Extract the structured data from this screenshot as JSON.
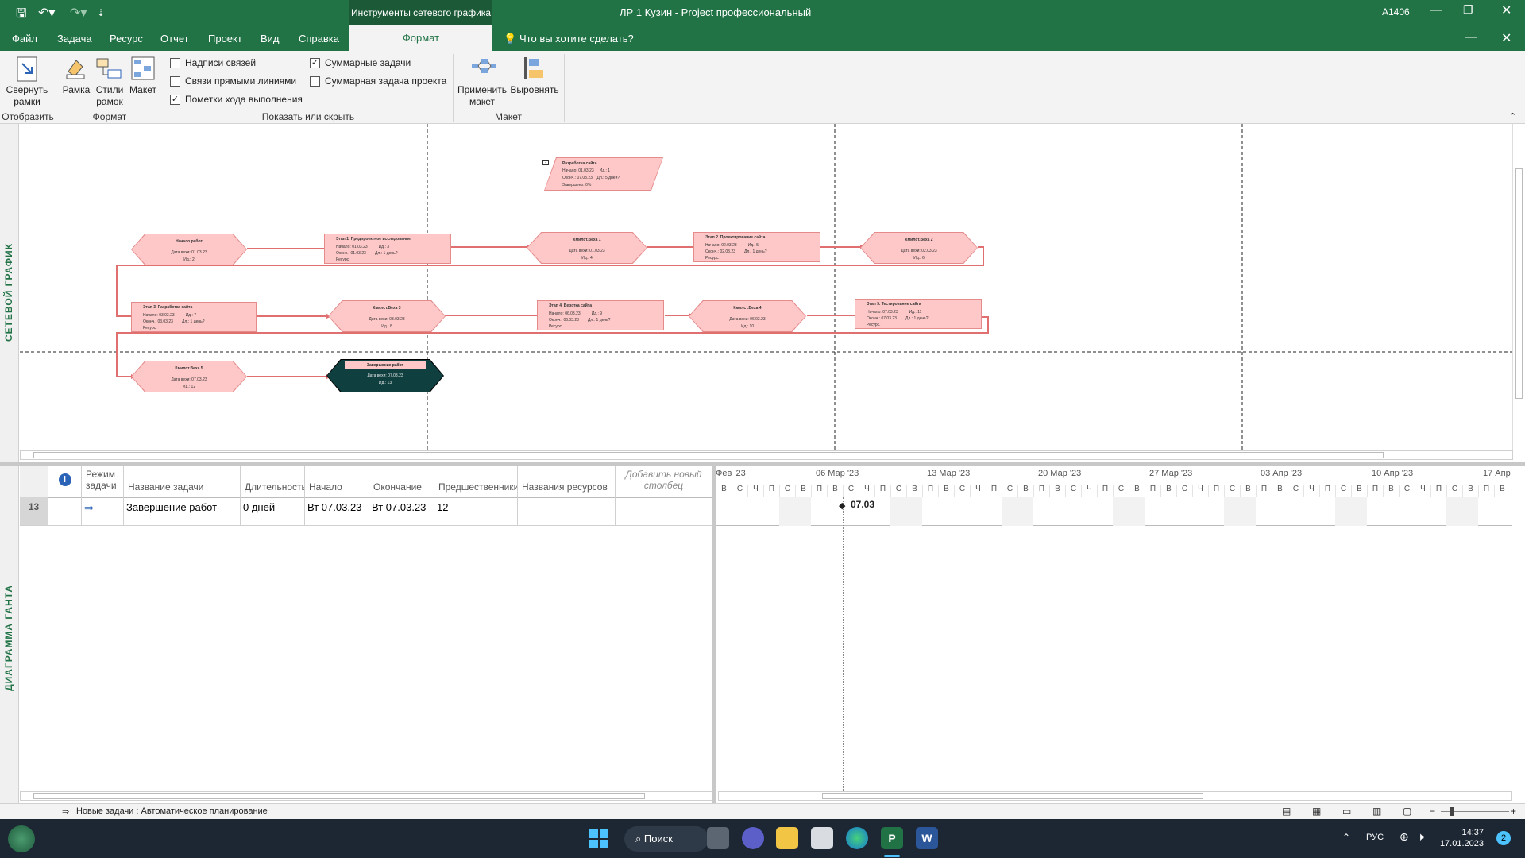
{
  "titlebar": {
    "context_tab": "Инструменты сетевого графика",
    "title": "ЛР 1 Кузин  -  Project профессиональный",
    "user": "А1406"
  },
  "tabs": [
    "Файл",
    "Задача",
    "Ресурс",
    "Отчет",
    "Проект",
    "Вид",
    "Справка",
    "Формат"
  ],
  "search_placeholder": "Что вы хотите сделать?",
  "ribbon": {
    "collapse_label": "Свернуть рамки",
    "box_label": "Рамка",
    "box_styles_label": "Стили рамок",
    "layout_label": "Макет",
    "apply_layout_label": "Применить макет",
    "align_label": "Выровнять",
    "groups": {
      "show": "Отобразить",
      "format": "Формат",
      "show_hide": "Показать или скрыть",
      "layout": "Макет"
    },
    "checkboxes": [
      {
        "label": "Надписи связей",
        "checked": false
      },
      {
        "label": "Связи прямыми линиями",
        "checked": false
      },
      {
        "label": "Пометки хода выполнения",
        "checked": true
      },
      {
        "label": "Суммарные задачи",
        "checked": true
      },
      {
        "label": "Суммарная задача проекта",
        "checked": false
      }
    ]
  },
  "network": {
    "view_label": "СЕТЕВОЙ ГРАФИК",
    "summary": {
      "title": "Разработка сайта",
      "start": "Начало: 01.03.23",
      "id": "Ид.: 1",
      "finish": "Оконч.: 07.03.23",
      "dur": "Дл.: 5 дней?",
      "complete": "Завершено: 0%"
    },
    "nodes": [
      {
        "shape": "hex",
        "title": "Начало работ",
        "date": "Дата вехи: 01.03.23",
        "id": "Ид.: 2"
      },
      {
        "shape": "rect",
        "title": "Этап 1. Предпроектное исследование",
        "start": "Начало: 01.03.23",
        "id": "Ид.: 3",
        "finish": "Оконч.: 01.03.23",
        "dur": "Дл.: 1 день?",
        "res": "Ресурс."
      },
      {
        "shape": "hex",
        "title": "Кмилст.Веха 1",
        "date": "Дата вехи: 01.03.23",
        "id": "Ид.: 4"
      },
      {
        "shape": "rect",
        "title": "Этап 2. Проектирование сайта",
        "start": "Начало: 02.03.23",
        "id": "Ид.: 5",
        "finish": "Оконч.: 02.03.23",
        "dur": "Дл.: 1 день?",
        "res": "Ресурс."
      },
      {
        "shape": "hex",
        "title": "Кмилст.Веха 2",
        "date": "Дата вехи: 02.03.23",
        "id": "Ид.: 6"
      },
      {
        "shape": "rect",
        "title": "Этап 3. Разработка сайта",
        "start": "Начало: 03.03.23",
        "id": "Ид.: 7",
        "finish": "Оконч.: 03.03.23",
        "dur": "Дл.: 1 день?",
        "res": "Ресурс."
      },
      {
        "shape": "hex",
        "title": "Кмилст.Веха 3",
        "date": "Дата вехи: 03.03.23",
        "id": "Ид.: 8"
      },
      {
        "shape": "rect",
        "title": "Этап 4. Верстка сайта",
        "start": "Начало: 06.03.23",
        "id": "Ид.: 9",
        "finish": "Оконч.: 06.03.23",
        "dur": "Дл.: 1 день?",
        "res": "Ресурс."
      },
      {
        "shape": "hex",
        "title": "Кмилст.Веха 4",
        "date": "Дата вехи: 06.03.23",
        "id": "Ид.: 10"
      },
      {
        "shape": "rect",
        "title": "Этап 5. Тестирование сайта",
        "start": "Начало: 07.03.23",
        "id": "Ид.: 11",
        "finish": "Оконч.: 07.03.23",
        "dur": "Дл.: 1 день?",
        "res": "Ресурс."
      },
      {
        "shape": "hex",
        "title": "Кмилст.Веха 5",
        "date": "Дата вехи: 07.03.23",
        "id": "Ид.: 12"
      },
      {
        "shape": "hex-selected",
        "title": "Завершение работ",
        "date": "Дата вехи: 07.03.23",
        "id": "Ид.: 13"
      }
    ]
  },
  "gantt": {
    "view_label": "ДИАГРАММА ГАНТА",
    "columns": [
      "Режим задачи",
      "Название задачи",
      "Длительность",
      "Начало",
      "Окончание",
      "Предшественники",
      "Названия ресурсов",
      "Добавить новый столбец"
    ],
    "row": {
      "num": "13",
      "name": "Завершение работ",
      "duration": "0 дней",
      "start": "Вт 07.03.23",
      "finish": "Вт 07.03.23",
      "pred": "12",
      "res": ""
    },
    "timescale_weeks": [
      "Фев '23",
      "06 Мар '23",
      "13 Мар '23",
      "20 Мар '23",
      "27 Мар '23",
      "03 Апр '23",
      "10 Апр '23",
      "17 Апр"
    ],
    "day_letters": [
      "В",
      "С",
      "Ч",
      "П",
      "С",
      "В",
      "П",
      "В",
      "С",
      "Ч",
      "П",
      "С",
      "В",
      "П",
      "В",
      "С",
      "Ч",
      "П",
      "С",
      "В",
      "П",
      "В",
      "С",
      "Ч",
      "П",
      "С",
      "В",
      "П",
      "В",
      "С",
      "Ч",
      "П",
      "С",
      "В",
      "П",
      "В",
      "С",
      "Ч",
      "П",
      "С",
      "В",
      "П",
      "В",
      "С",
      "Ч",
      "П",
      "С",
      "В",
      "П",
      "В"
    ],
    "milestone_label": "07.03"
  },
  "status": {
    "new_tasks": "Новые задачи : Автоматическое планирование"
  },
  "taskbar": {
    "search": "Поиск",
    "lang": "РУС",
    "time": "14:37",
    "date": "17.01.2023",
    "badge": "2"
  }
}
